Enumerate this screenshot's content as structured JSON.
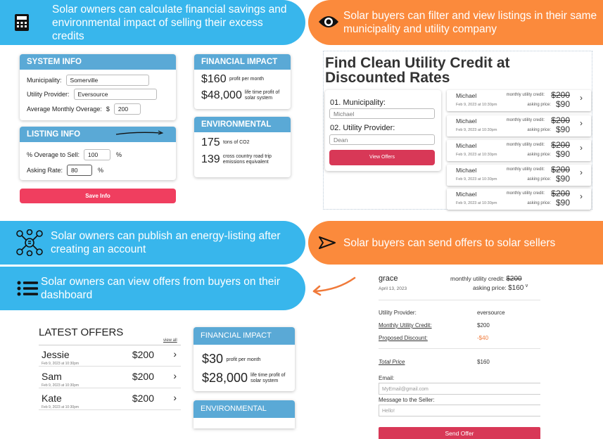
{
  "banners": {
    "calc": "Solar owners can calculate financial savings and environmental impact of selling their excess credits",
    "filter": "Solar buyers can filter and view listings in their same municipality and utility company",
    "publish": "Solar owners can publish an energy-listing  after creating an account",
    "send": "Solar buyers can send offers to solar sellers",
    "view": "Solar owners can view offers from buyers on their dashboard"
  },
  "system_info": {
    "title": "SYSTEM INFO",
    "municipality_label": "Municipality:",
    "municipality_value": "Somerville",
    "provider_label": "Utility Provider:",
    "provider_value": "Eversource",
    "overage_label": "Average Monthly Overage:",
    "overage_unit": "$",
    "overage_value": "200"
  },
  "listing_info": {
    "title": "LISTING INFO",
    "sell_label": "% Overage to Sell:",
    "sell_value": "100",
    "sell_unit": "%",
    "rate_label": "Asking Rate:",
    "rate_value": "80",
    "rate_unit": "%",
    "save_label": "Save Info"
  },
  "financial_1": {
    "title": "FINANCIAL IMPACT",
    "profit_value": "$160",
    "profit_label": "profit per month",
    "lifetime_value": "$48,000",
    "lifetime_label": "life time profit of solar system"
  },
  "environmental_1": {
    "title": "ENVIRONMENTAL IMPACT",
    "co2_value": "175",
    "co2_label": "tons of CO2",
    "trips_value": "139",
    "trips_label": "cross country road trip emissions equivalent"
  },
  "find": {
    "title": "Find Clean Utility Credit at Discounted Rates",
    "municipality_label": "01. Municipality:",
    "municipality_placeholder": "Michael",
    "provider_label": "02. Utility Provider:",
    "provider_placeholder": "Dean",
    "view_offers": "View Offers"
  },
  "listings": [
    {
      "name": "Michael",
      "date": "Feb 9, 2023 at 10:30pm",
      "credit_label": "monthly utility credit:",
      "credit": "$200",
      "ask_label": "asking price:",
      "price": "$90"
    },
    {
      "name": "Michael",
      "date": "Feb 9, 2023 at 10:30pm",
      "credit_label": "monthly utility credit:",
      "credit": "$200",
      "ask_label": "asking price:",
      "price": "$90"
    },
    {
      "name": "Michael",
      "date": "Feb 9, 2023 at 10:30pm",
      "credit_label": "monthly utility credit:",
      "credit": "$200",
      "ask_label": "asking price:",
      "price": "$90"
    },
    {
      "name": "Michael",
      "date": "Feb 9, 2023 at 10:30pm",
      "credit_label": "monthly utility credit:",
      "credit": "$200",
      "ask_label": "asking price:",
      "price": "$90"
    },
    {
      "name": "Michael",
      "date": "Feb 9, 2023 at 10:30pm",
      "credit_label": "monthly utility credit:",
      "credit": "$200",
      "ask_label": "asking price:",
      "price": "$90"
    }
  ],
  "latest_offers": {
    "title": "LATEST OFFERS",
    "view_all": "view all",
    "rows": [
      {
        "name": "Jessie",
        "date": "Feb 9, 2023 at 10:30pm",
        "amount": "$200"
      },
      {
        "name": "Sam",
        "date": "Feb 9, 2023 at 10:30pm",
        "amount": "$200"
      },
      {
        "name": "Kate",
        "date": "Feb 9, 2023 at 10:30pm",
        "amount": "$200"
      }
    ]
  },
  "financial_2": {
    "title": "FINANCIAL IMPACT",
    "profit_value": "$30",
    "profit_label": "profit per month",
    "lifetime_value": "$28,000",
    "lifetime_label": "life time profit of solar system"
  },
  "environmental_2": {
    "title": "ENVIRONMENTAL IMPACT"
  },
  "offer_detail": {
    "name": "grace",
    "date": "April 13, 2023",
    "credit_label": "monthly utility credit:",
    "credit": "$200",
    "ask_label": "asking price:",
    "price": "$160",
    "chevron": "v",
    "provider_label": "Utility Provider:",
    "provider_value": "eversource",
    "monthly_label": "Monthly Utility Credit:",
    "monthly_value": "$200",
    "discount_label": "Proposed Discount:",
    "discount_value": "-$40",
    "total_label": "Total Price",
    "total_value": "$160",
    "email_label": "Email:",
    "email_placeholder": "MyEmail@gmail.com",
    "message_label": "Message to the Seller:",
    "message_placeholder": "Hello!",
    "send_label": "Send Offer"
  },
  "colors": {
    "blue": "#38b6ec",
    "orange": "#fb8a3c",
    "header_blue": "#5aa9d6",
    "accent_red": "#f03e5f"
  }
}
